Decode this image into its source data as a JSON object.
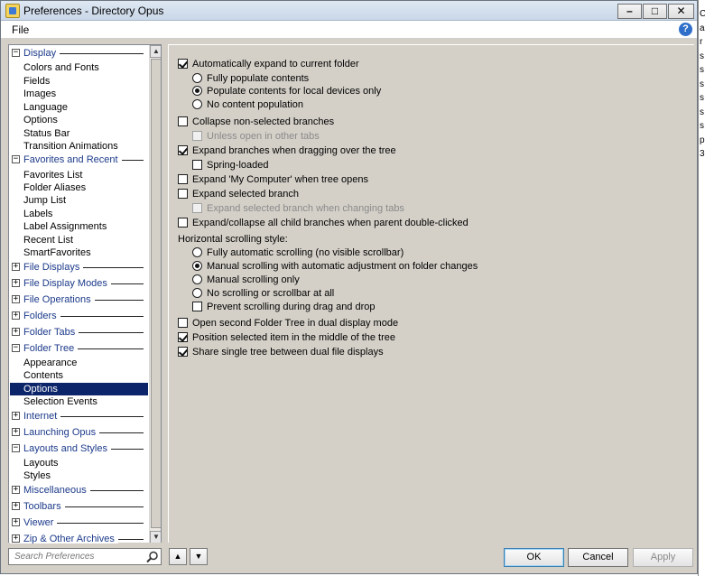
{
  "window": {
    "title": "Preferences - Directory Opus",
    "minimize_glyph": "–",
    "maximize_glyph": "□",
    "close_glyph": "✕"
  },
  "menu": {
    "file": "File",
    "help_glyph": "?"
  },
  "background_letters": [
    "C",
    "a",
    "r",
    "s",
    "s",
    "s",
    "s",
    "s",
    "s",
    "p",
    "3"
  ],
  "tree": {
    "items": [
      {
        "type": "cat",
        "label": "Display",
        "expander": "−"
      },
      {
        "type": "child",
        "label": "Colors and Fonts"
      },
      {
        "type": "child",
        "label": "Fields"
      },
      {
        "type": "child",
        "label": "Images"
      },
      {
        "type": "child",
        "label": "Language"
      },
      {
        "type": "child",
        "label": "Options"
      },
      {
        "type": "child",
        "label": "Status Bar"
      },
      {
        "type": "child",
        "label": "Transition Animations"
      },
      {
        "type": "cat",
        "label": "Favorites and Recent",
        "expander": "−"
      },
      {
        "type": "child",
        "label": "Favorites List"
      },
      {
        "type": "child",
        "label": "Folder Aliases"
      },
      {
        "type": "child",
        "label": "Jump List"
      },
      {
        "type": "child",
        "label": "Labels"
      },
      {
        "type": "child",
        "label": "Label Assignments"
      },
      {
        "type": "child",
        "label": "Recent List"
      },
      {
        "type": "child",
        "label": "SmartFavorites"
      },
      {
        "type": "cat",
        "label": "File Displays",
        "expander": "+"
      },
      {
        "type": "cat",
        "label": "File Display Modes",
        "expander": "+"
      },
      {
        "type": "cat",
        "label": "File Operations",
        "expander": "+"
      },
      {
        "type": "cat",
        "label": "Folders",
        "expander": "+"
      },
      {
        "type": "cat",
        "label": "Folder Tabs",
        "expander": "+"
      },
      {
        "type": "cat",
        "label": "Folder Tree",
        "expander": "−"
      },
      {
        "type": "child",
        "label": "Appearance"
      },
      {
        "type": "child",
        "label": "Contents"
      },
      {
        "type": "child",
        "label": "Options",
        "selected": true
      },
      {
        "type": "child",
        "label": "Selection Events"
      },
      {
        "type": "cat",
        "label": "Internet",
        "expander": "+"
      },
      {
        "type": "cat",
        "label": "Launching Opus",
        "expander": "+"
      },
      {
        "type": "cat",
        "label": "Layouts and Styles",
        "expander": "−"
      },
      {
        "type": "child",
        "label": "Layouts"
      },
      {
        "type": "child",
        "label": "Styles"
      },
      {
        "type": "cat",
        "label": "Miscellaneous",
        "expander": "+"
      },
      {
        "type": "cat",
        "label": "Toolbars",
        "expander": "+"
      },
      {
        "type": "cat",
        "label": "Viewer",
        "expander": "+"
      },
      {
        "type": "cat",
        "label": "Zip & Other Archives",
        "expander": "+"
      }
    ],
    "scroll_up_glyph": "▲",
    "scroll_down_glyph": "▼"
  },
  "options": {
    "auto_expand": {
      "label": "Automatically expand to current folder",
      "checked": true
    },
    "fully_populate": {
      "label": "Fully populate contents",
      "checked": false
    },
    "populate_local": {
      "label": "Populate contents for local devices only",
      "checked": true
    },
    "no_population": {
      "label": "No content population",
      "checked": false
    },
    "collapse_non_selected": {
      "label": "Collapse non-selected branches",
      "checked": false
    },
    "unless_open_tabs": {
      "label": "Unless open in other tabs",
      "checked": false,
      "disabled": true
    },
    "expand_dragging": {
      "label": "Expand branches when dragging over the tree",
      "checked": true
    },
    "spring_loaded": {
      "label": "Spring-loaded",
      "checked": false
    },
    "expand_my_computer": {
      "label": "Expand 'My Computer' when tree opens",
      "checked": false
    },
    "expand_selected": {
      "label": "Expand selected branch",
      "checked": false
    },
    "expand_selected_tabs": {
      "label": "Expand selected branch when changing tabs",
      "checked": false,
      "disabled": true
    },
    "expand_collapse_child": {
      "label": "Expand/collapse all child branches when parent double-clicked",
      "checked": false
    },
    "hscroll_heading": "Horizontal scrolling style:",
    "hs_fully_auto": {
      "label": "Fully automatic scrolling (no visible scrollbar)",
      "checked": false
    },
    "hs_manual_auto": {
      "label": "Manual scrolling with automatic adjustment on folder changes",
      "checked": true
    },
    "hs_manual_only": {
      "label": "Manual scrolling only",
      "checked": false
    },
    "hs_none": {
      "label": "No scrolling or scrollbar at all",
      "checked": false
    },
    "prevent_scroll_drag": {
      "label": "Prevent scrolling during drag and drop",
      "checked": false
    },
    "open_second_tree": {
      "label": "Open second Folder Tree in dual display mode",
      "checked": false
    },
    "position_middle": {
      "label": "Position selected item in the middle of the tree",
      "checked": true
    },
    "share_single_tree": {
      "label": "Share single tree between dual file displays",
      "checked": true
    }
  },
  "bottom": {
    "search_placeholder": "Search Preferences",
    "nav_up_glyph": "▲",
    "nav_down_glyph": "▼",
    "ok": "OK",
    "cancel": "Cancel",
    "apply": "Apply"
  }
}
